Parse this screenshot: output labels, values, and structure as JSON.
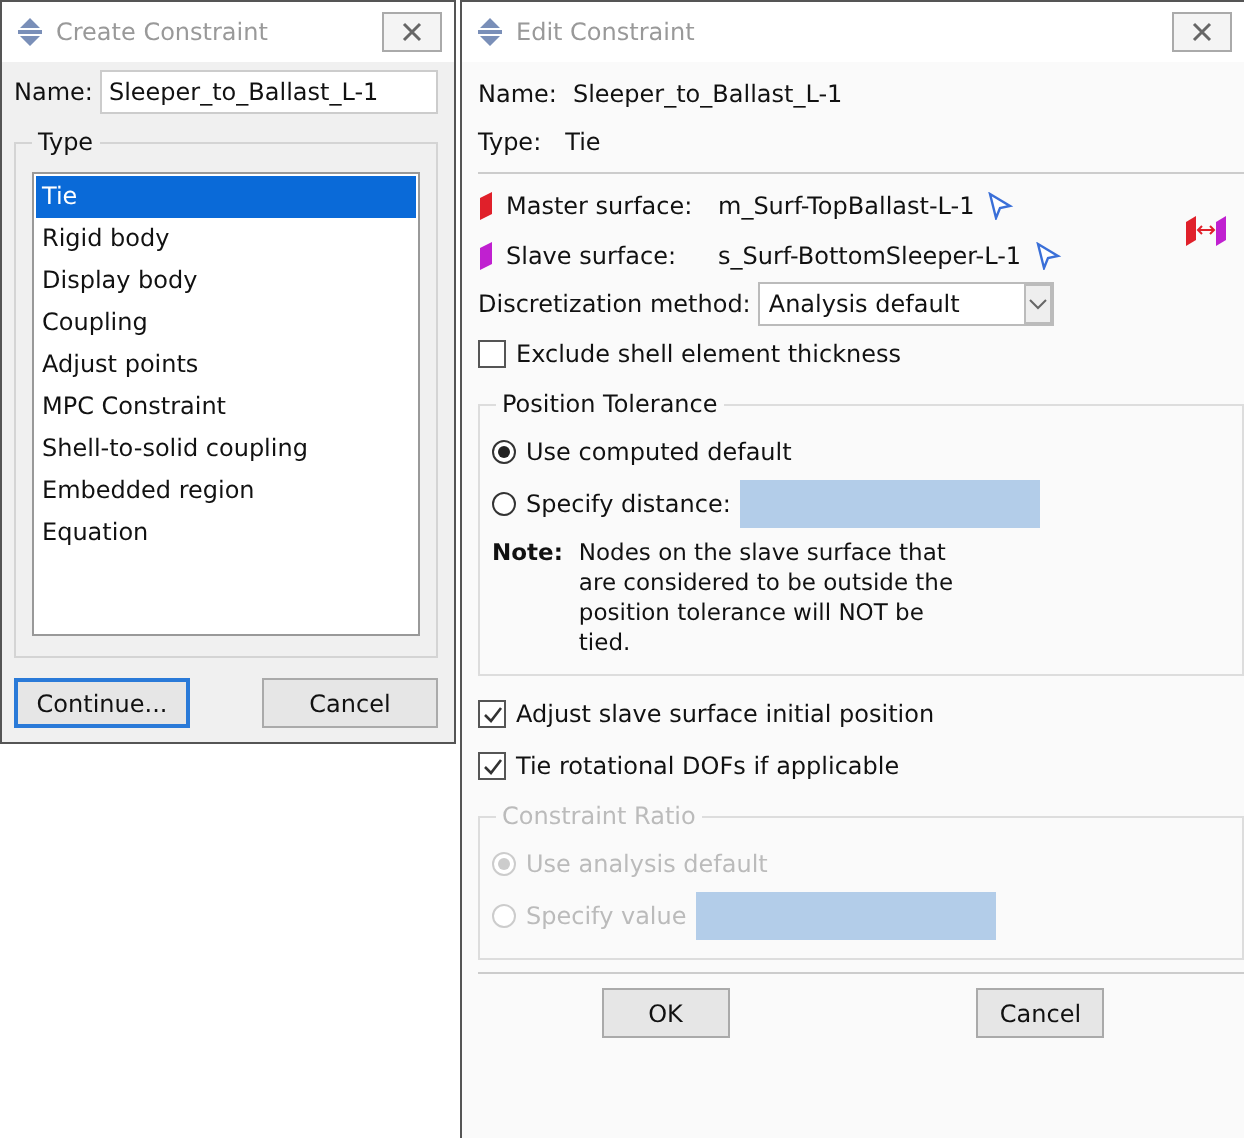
{
  "create_dialog": {
    "title": "Create Constraint",
    "name_label": "Name:",
    "name_value": "Sleeper_to_Ballast_L-1",
    "type_group": "Type",
    "types": [
      {
        "label": "Tie",
        "selected": true
      },
      {
        "label": "Rigid body",
        "selected": false
      },
      {
        "label": "Display body",
        "selected": false
      },
      {
        "label": "Coupling",
        "selected": false
      },
      {
        "label": "Adjust points",
        "selected": false
      },
      {
        "label": "MPC Constraint",
        "selected": false
      },
      {
        "label": "Shell-to-solid coupling",
        "selected": false
      },
      {
        "label": "Embedded region",
        "selected": false
      },
      {
        "label": "Equation",
        "selected": false
      }
    ],
    "buttons": [
      {
        "label": "Continue...",
        "focused": true
      },
      {
        "label": "Cancel",
        "focused": false
      }
    ]
  },
  "edit_dialog": {
    "title": "Edit Constraint",
    "name_label": "Name:",
    "name_value": "Sleeper_to_Ballast_L-1",
    "type_label": "Type:",
    "type_value": "Tie",
    "surfaces": [
      {
        "label": "Master surface:",
        "value": "m_Surf-TopBallast-L-1",
        "color": "#e0202a"
      },
      {
        "label": "Slave surface:",
        "value": "s_Surf-BottomSleeper-L-1",
        "color": "#c020d0"
      }
    ],
    "discretization": {
      "label": "Discretization method:",
      "value": "Analysis default"
    },
    "exclude_shell": {
      "label": "Exclude shell element thickness",
      "checked": false
    },
    "position_tolerance": {
      "title": "Position Tolerance",
      "options": [
        {
          "label": "Use computed default",
          "selected": true,
          "has_field": false
        },
        {
          "label": "Specify distance:",
          "selected": false,
          "has_field": true
        }
      ],
      "note_label": "Note:",
      "note_text": "Nodes on the slave surface that are considered to be outside the position tolerance will NOT be tied."
    },
    "checks": [
      {
        "label": "Adjust slave surface initial position",
        "checked": true
      },
      {
        "label": "Tie rotational DOFs if applicable",
        "checked": true
      }
    ],
    "constraint_ratio": {
      "title": "Constraint Ratio",
      "disabled": true,
      "options": [
        {
          "label": "Use analysis default",
          "selected": true,
          "has_field": false
        },
        {
          "label": "Specify value",
          "selected": false,
          "has_field": true
        }
      ]
    },
    "buttons": [
      {
        "label": "OK"
      },
      {
        "label": "Cancel"
      }
    ]
  }
}
